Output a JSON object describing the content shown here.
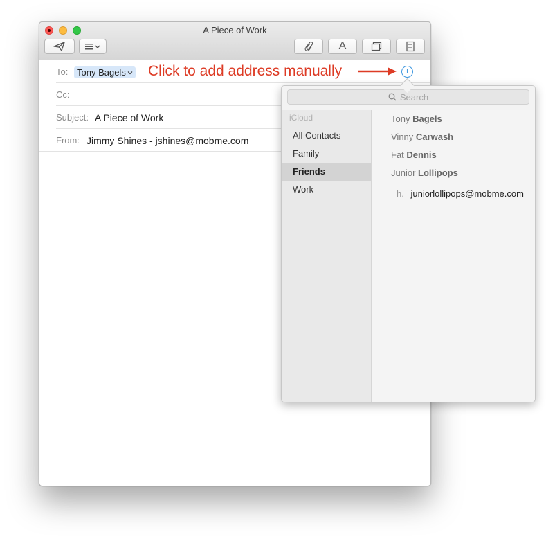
{
  "window": {
    "title": "A Piece of Work"
  },
  "toolbar": {
    "send_icon": "paper-plane-icon",
    "header_fields_icon": "list-icon",
    "attach_icon": "paperclip-icon",
    "format_label": "A",
    "photo_browser_icon": "photo-browser-icon",
    "stationery_icon": "stationery-icon"
  },
  "compose": {
    "to_label": "To:",
    "to_token": "Tony Bagels",
    "cc_label": "Cc:",
    "subject_label": "Subject:",
    "subject_value": "A Piece of Work",
    "from_label": "From:",
    "from_value": "Jimmy Shines - jshines@mobme.com"
  },
  "annotation": {
    "text": "Click to add address manually",
    "color": "#dd3b25"
  },
  "popover": {
    "search_placeholder": "Search",
    "section_label": "iCloud",
    "groups": [
      "All Contacts",
      "Family",
      "Friends",
      "Work"
    ],
    "selected_group": "Friends",
    "contacts": [
      {
        "first": "Tony",
        "last": "Bagels"
      },
      {
        "first": "Vinny",
        "last": "Carwash"
      },
      {
        "first": "Fat",
        "last": "Dennis"
      },
      {
        "first": "Junior",
        "last": "Lollipops"
      }
    ],
    "expanded_email": {
      "label": "h.",
      "value": "juniorlollipops@mobme.com"
    }
  },
  "colors": {
    "accent": "#3f98e0",
    "token_bg": "#d7e7f9",
    "selected_group_bg": "#d3d3d3"
  }
}
